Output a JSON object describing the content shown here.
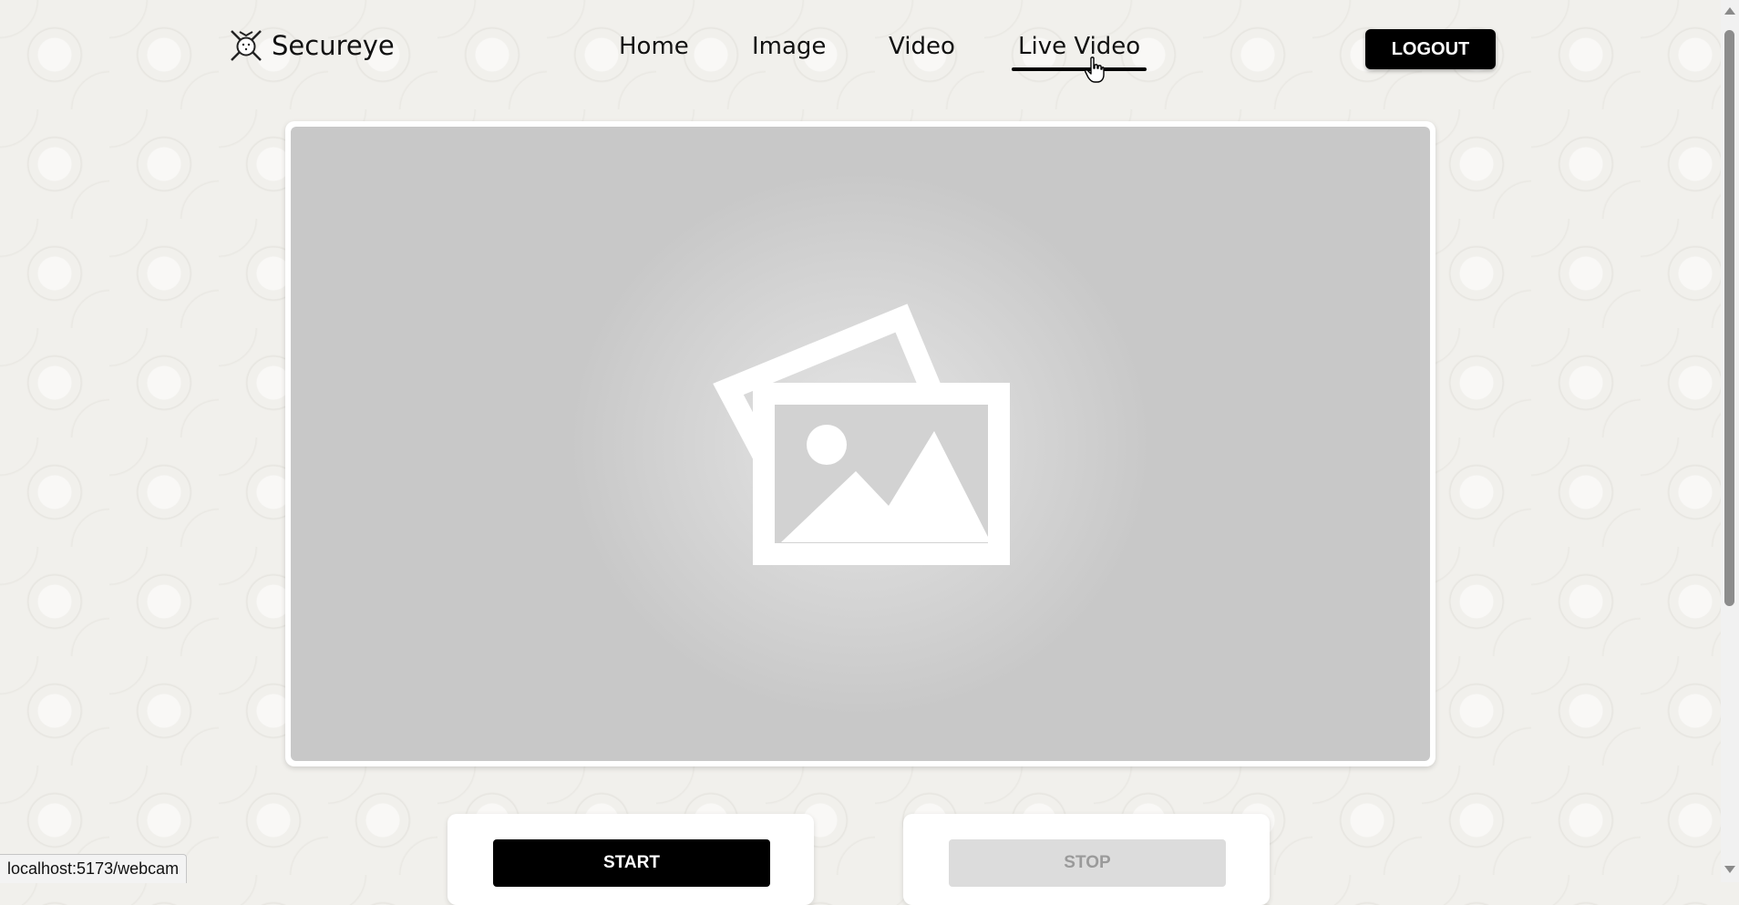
{
  "brand": {
    "name": "Secureye",
    "logo_icon": "shield-crossed-swords-icon"
  },
  "nav": {
    "items": [
      {
        "label": "Home"
      },
      {
        "label": "Image"
      },
      {
        "label": "Video"
      },
      {
        "label": "Live Video",
        "active": true
      }
    ]
  },
  "header": {
    "logout_label": "LOGOUT"
  },
  "viewer": {
    "placeholder_icon": "image-placeholder-icon"
  },
  "controls": {
    "start_label": "START",
    "stop_label": "STOP",
    "stop_disabled": true
  },
  "status_bar": {
    "url": "localhost:5173/webcam"
  },
  "colors": {
    "accent": "#000000",
    "disabled_bg": "#dcdcdc",
    "disabled_text": "#9a9a9a"
  }
}
